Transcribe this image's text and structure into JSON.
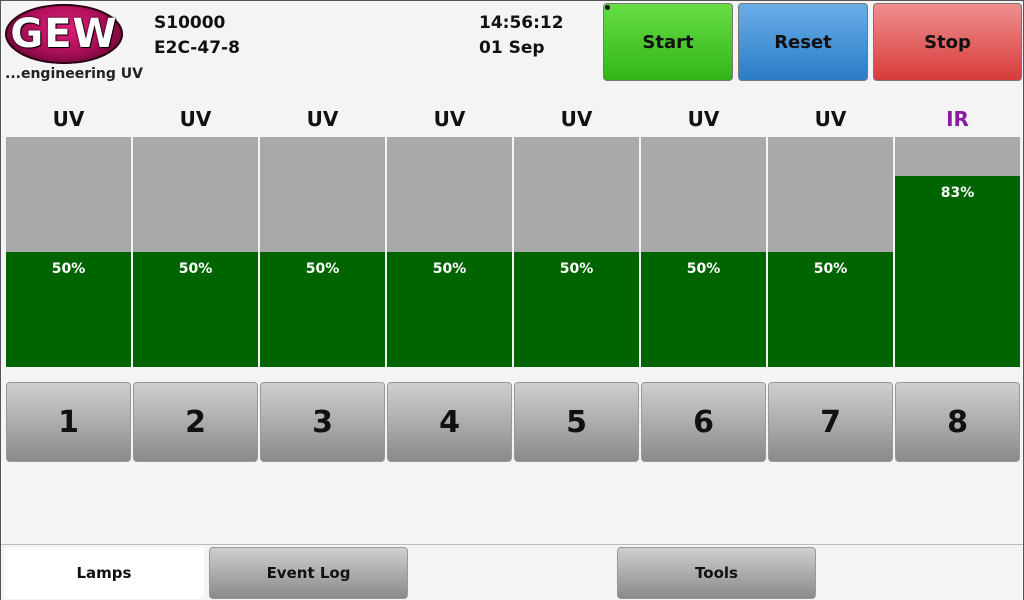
{
  "header": {
    "logo_text": "GEW",
    "logo_tagline": "...engineering UV",
    "system_id": "S10000",
    "system_model": "E2C-47-8",
    "time": "14:56:12",
    "date": "01 Sep"
  },
  "controls": {
    "start_label": "Start",
    "reset_label": "Reset",
    "stop_label": "Stop"
  },
  "lamps": [
    {
      "type": "UV",
      "percent_label": "50%",
      "power": 0.5,
      "number": "1"
    },
    {
      "type": "UV",
      "percent_label": "50%",
      "power": 0.5,
      "number": "2"
    },
    {
      "type": "UV",
      "percent_label": "50%",
      "power": 0.5,
      "number": "3"
    },
    {
      "type": "UV",
      "percent_label": "50%",
      "power": 0.5,
      "number": "4"
    },
    {
      "type": "UV",
      "percent_label": "50%",
      "power": 0.5,
      "number": "5"
    },
    {
      "type": "UV",
      "percent_label": "50%",
      "power": 0.5,
      "number": "6"
    },
    {
      "type": "UV",
      "percent_label": "50%",
      "power": 0.5,
      "number": "7"
    },
    {
      "type": "IR",
      "percent_label": "83%",
      "power": 0.83,
      "number": "8"
    }
  ],
  "tabs": {
    "lamps_label": "Lamps",
    "eventlog_label": "Event Log",
    "tools_label": "Tools"
  },
  "colors": {
    "fill_green": "#006400",
    "bar_grey": "#a9a9a9",
    "ir_label": "#8a1aa0",
    "start_green": "#44c42a",
    "reset_blue": "#3a8ed6",
    "stop_red": "#e05555"
  }
}
